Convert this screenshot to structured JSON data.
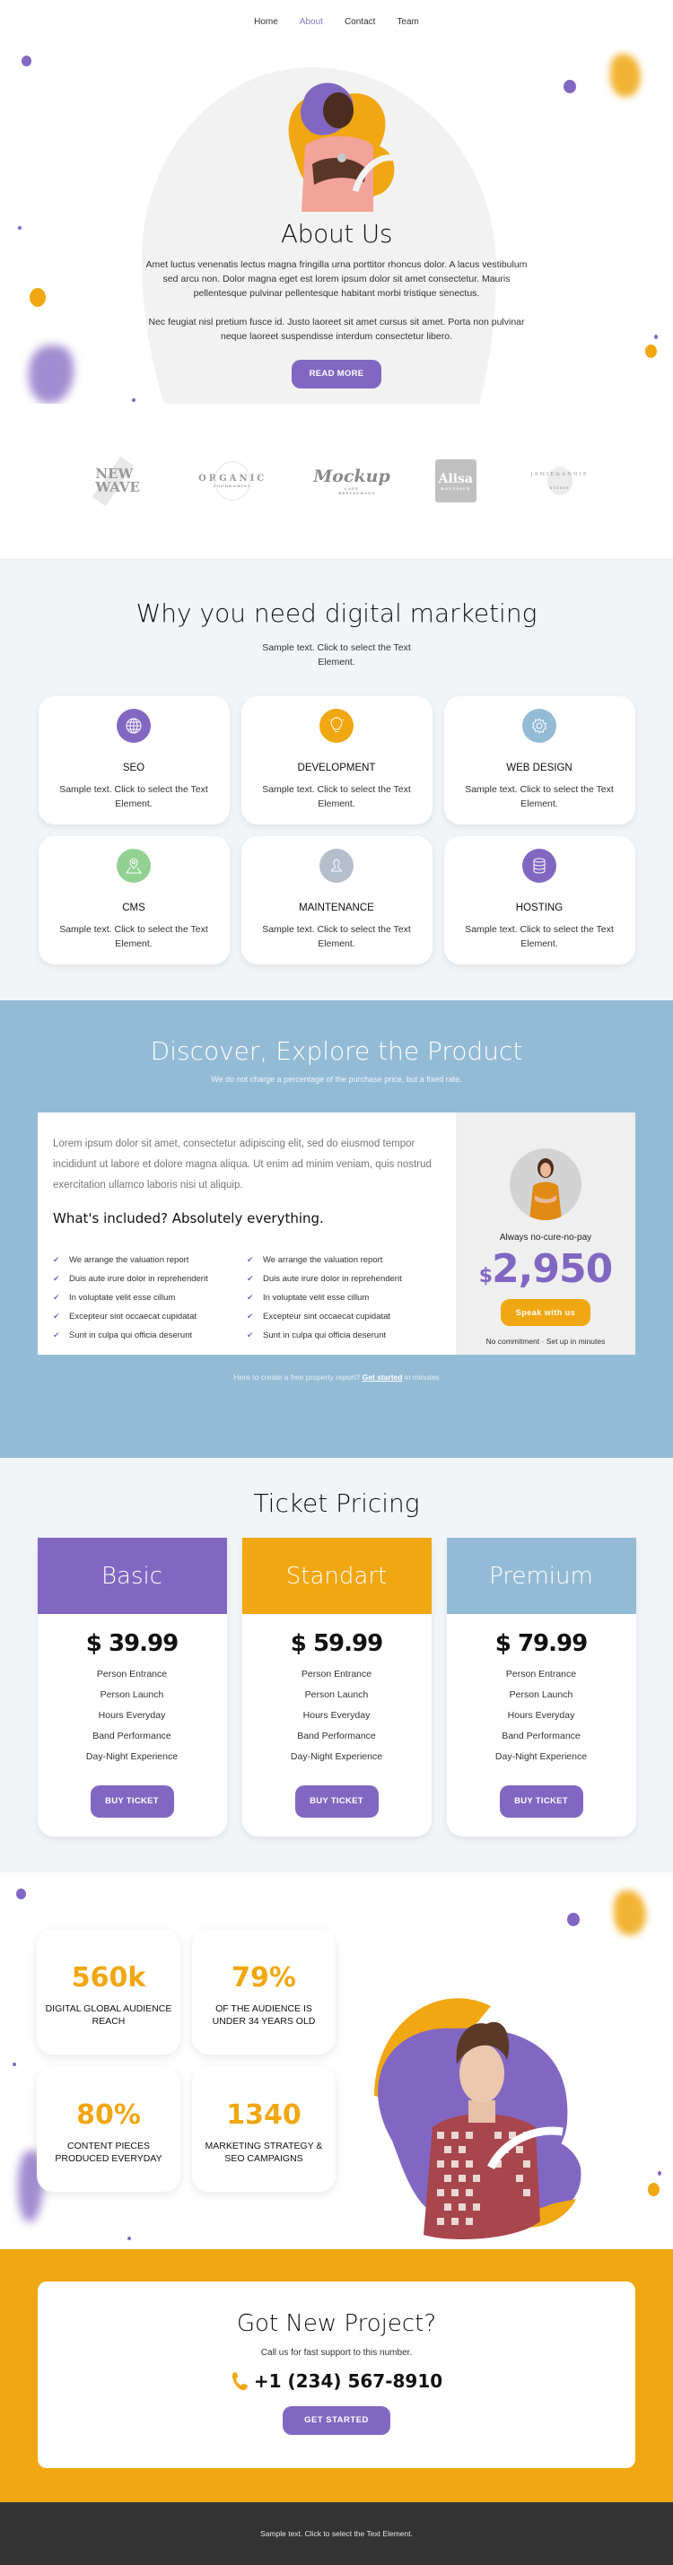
{
  "nav": {
    "items": [
      {
        "label": "Home"
      },
      {
        "label": "About",
        "active": true
      },
      {
        "label": "Contact"
      },
      {
        "label": "Team"
      }
    ]
  },
  "hero": {
    "title": "About Us",
    "p1": "Amet luctus venenatis lectus magna fringilla urna porttitor rhoncus dolor. A lacus vestibulum sed arcu non. Dolor magna eget est lorem ipsum dolor sit amet consectetur. Mauris pellentesque pulvinar pellentesque habitant morbi tristique senectus.",
    "p2": "Nec feugiat nisl pretium fusce id. Justo laoreet sit amet cursus sit amet. Porta non pulvinar neque laoreet suspendisse interdum consectetur libero.",
    "button": "READ MORE"
  },
  "logos": [
    {
      "name": "NEW WAVE"
    },
    {
      "name": "ORGANIC",
      "sub": "FOOD&DRINK"
    },
    {
      "name": "Mockup",
      "sub": "CAFE RESTAURANT"
    },
    {
      "name": "Alisa",
      "sub": "BOUTIQUE"
    },
    {
      "name": "JAMIE&ANNIE",
      "sub": "STUDIO"
    }
  ],
  "why": {
    "title": "Why you need digital marketing",
    "subtitle": "Sample text. Click to select the Text Element.",
    "cards": [
      {
        "title": "SEO",
        "text": "Sample text. Click to select the Text Element.",
        "icon": "globe-icon",
        "color": "#8267c2"
      },
      {
        "title": "DEVELOPMENT",
        "text": "Sample text. Click to select the Text Element.",
        "icon": "lightbulb-icon",
        "color": "#f0a711"
      },
      {
        "title": "WEB DESIGN",
        "text": "Sample text. Click to select the Text Element.",
        "icon": "gear-icon",
        "color": "#94bbd6"
      },
      {
        "title": "CMS",
        "text": "Sample text. Click to select the Text Element.",
        "icon": "map-pin-icon",
        "color": "#93d193"
      },
      {
        "title": "MAINTENANCE",
        "text": "Sample text. Click to select the Text Element.",
        "icon": "user-icon",
        "color": "#b5bfcc"
      },
      {
        "title": "HOSTING",
        "text": "Sample text. Click to select the Text Element.",
        "icon": "database-icon",
        "color": "#8267c2"
      }
    ]
  },
  "discover": {
    "title": "Discover, Explore the Product",
    "tagline": "We do not charge a percentage of the purchase price, but a fixed rate.",
    "lorem": "Lorem ipsum dolor sit amet, consectetur adipiscing elit, sed do eiusmod tempor incididunt ut labore et dolore magna aliqua. Ut enim ad minim veniam, quis nostrud exercitation ullamco laboris nisi ut aliquip.",
    "included_title": "What's included? Absolutely everything.",
    "checks_left": [
      "We arrange the valuation report",
      "Duis aute irure dolor in reprehenderit",
      "In voluptate velit esse cillum",
      "Excepteur sint occaecat cupidatat",
      "Sunt in culpa qui officia deserunt"
    ],
    "checks_right": [
      "We arrange the valuation report",
      "Duis aute irure dolor in reprehenderit",
      "In voluptate velit esse cillum",
      "Excepteur sint occaecat cupidatat",
      "Sunt in culpa qui officia deserunt"
    ],
    "always": "Always no-cure-no-pay",
    "currency": "$",
    "price": "2,950",
    "cta": "Speak with us",
    "note": "No commitment · Set up in minutes",
    "footnote_pre": "Here to create a free property report? ",
    "footnote_link": "Get started",
    "footnote_post": " in minutes"
  },
  "pricing": {
    "title": "Ticket Pricing",
    "plans": [
      {
        "name": "Basic",
        "price": "$ 39.99",
        "color": "#8267c2",
        "features": [
          "Person Entrance",
          "Person Launch",
          "Hours Everyday",
          "Band Performance",
          "Day-Night Experience"
        ],
        "button": "BUY TICKET"
      },
      {
        "name": "Standart",
        "price": "$ 59.99",
        "color": "#f0a711",
        "features": [
          "Person Entrance",
          "Person Launch",
          "Hours Everyday",
          "Band Performance",
          "Day-Night Experience"
        ],
        "button": "BUY TICKET"
      },
      {
        "name": "Premium",
        "price": "$ 79.99",
        "color": "#94bbd6",
        "features": [
          "Person Entrance",
          "Person Launch",
          "Hours Everyday",
          "Band Performance",
          "Day-Night Experience"
        ],
        "button": "BUY TICKET"
      }
    ]
  },
  "stats": [
    {
      "num": "560k",
      "label": "DIGITAL GLOBAL AUDIENCE REACH"
    },
    {
      "num": "79%",
      "label": "OF THE AUDIENCE IS UNDER 34 YEARS OLD"
    },
    {
      "num": "80%",
      "label": "CONTENT PIECES PRODUCED EVERYDAY"
    },
    {
      "num": "1340",
      "label": "MARKETING STRATEGY & SEO CAMPAIGNS"
    }
  ],
  "cta": {
    "title": "Got New Project?",
    "subtitle": "Call us for fast support to this number.",
    "phone": "+1 (234) 567-8910",
    "button": "GET STARTED"
  },
  "footer": {
    "text": "Sample text. Click to select the Text Element."
  },
  "colors": {
    "purple": "#8267c2",
    "orange": "#f0a711",
    "blue": "#94bbd6",
    "dark": "#333333"
  }
}
